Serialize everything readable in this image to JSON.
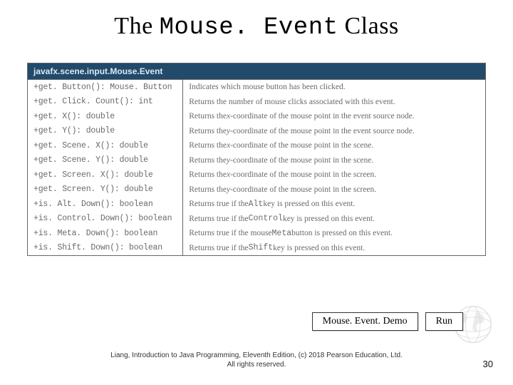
{
  "title_prefix": "The ",
  "title_mono": "Mouse. Event",
  "title_suffix": " Class",
  "uml": {
    "header": "javafx.scene.input.Mouse.Event",
    "methods": [
      "+get. Button(): Mouse. Button",
      "+get. Click. Count(): int",
      "+get. X(): double",
      "+get. Y(): double",
      "+get. Scene. X(): double",
      "+get. Scene. Y(): double",
      "+get. Screen. X(): double",
      "+get. Screen. Y(): double",
      "+is. Alt. Down(): boolean",
      "+is. Control. Down(): boolean",
      "+is. Meta. Down(): boolean",
      "+is. Shift. Down(): boolean"
    ],
    "descriptions": [
      [
        {
          "t": "Indicates which mouse button has been clicked."
        }
      ],
      [
        {
          "t": "Returns the number of mouse clicks associated with this event."
        }
      ],
      [
        {
          "t": "Returns the "
        },
        {
          "t": "x",
          "i": true
        },
        {
          "t": "-coordinate of the mouse point in the event source node."
        }
      ],
      [
        {
          "t": "Returns the "
        },
        {
          "t": "y",
          "i": true
        },
        {
          "t": "-coordinate of the mouse point in the event source node."
        }
      ],
      [
        {
          "t": "Returns the "
        },
        {
          "t": "x",
          "i": true
        },
        {
          "t": "-coordinate of the mouse point in the scene."
        }
      ],
      [
        {
          "t": "Returns the "
        },
        {
          "t": "y",
          "i": true
        },
        {
          "t": "-coordinate of the mouse point in the scene."
        }
      ],
      [
        {
          "t": "Returns the "
        },
        {
          "t": "x",
          "i": true
        },
        {
          "t": "-coordinate of the mouse point in the screen."
        }
      ],
      [
        {
          "t": "Returns the "
        },
        {
          "t": "y",
          "i": true
        },
        {
          "t": "-coordinate of the mouse point in the screen."
        }
      ],
      [
        {
          "t": "Returns true if the "
        },
        {
          "t": "Alt",
          "m": true
        },
        {
          "t": " key is pressed on this event."
        }
      ],
      [
        {
          "t": "Returns true if the "
        },
        {
          "t": "Control",
          "m": true
        },
        {
          "t": " key is pressed on this event."
        }
      ],
      [
        {
          "t": "Returns true if the mouse "
        },
        {
          "t": "Meta",
          "m": true
        },
        {
          "t": " button is pressed on this event."
        }
      ],
      [
        {
          "t": "Returns true if the "
        },
        {
          "t": "Shift",
          "m": true
        },
        {
          "t": " key is pressed on this event."
        }
      ]
    ]
  },
  "buttons": {
    "demo": "Mouse. Event. Demo",
    "run": "Run"
  },
  "footnote_line1": "Liang, Introduction to Java Programming, Eleventh Edition, (c) 2018 Pearson Education, Ltd.",
  "footnote_line2": "All rights reserved.",
  "pagenum": "30"
}
